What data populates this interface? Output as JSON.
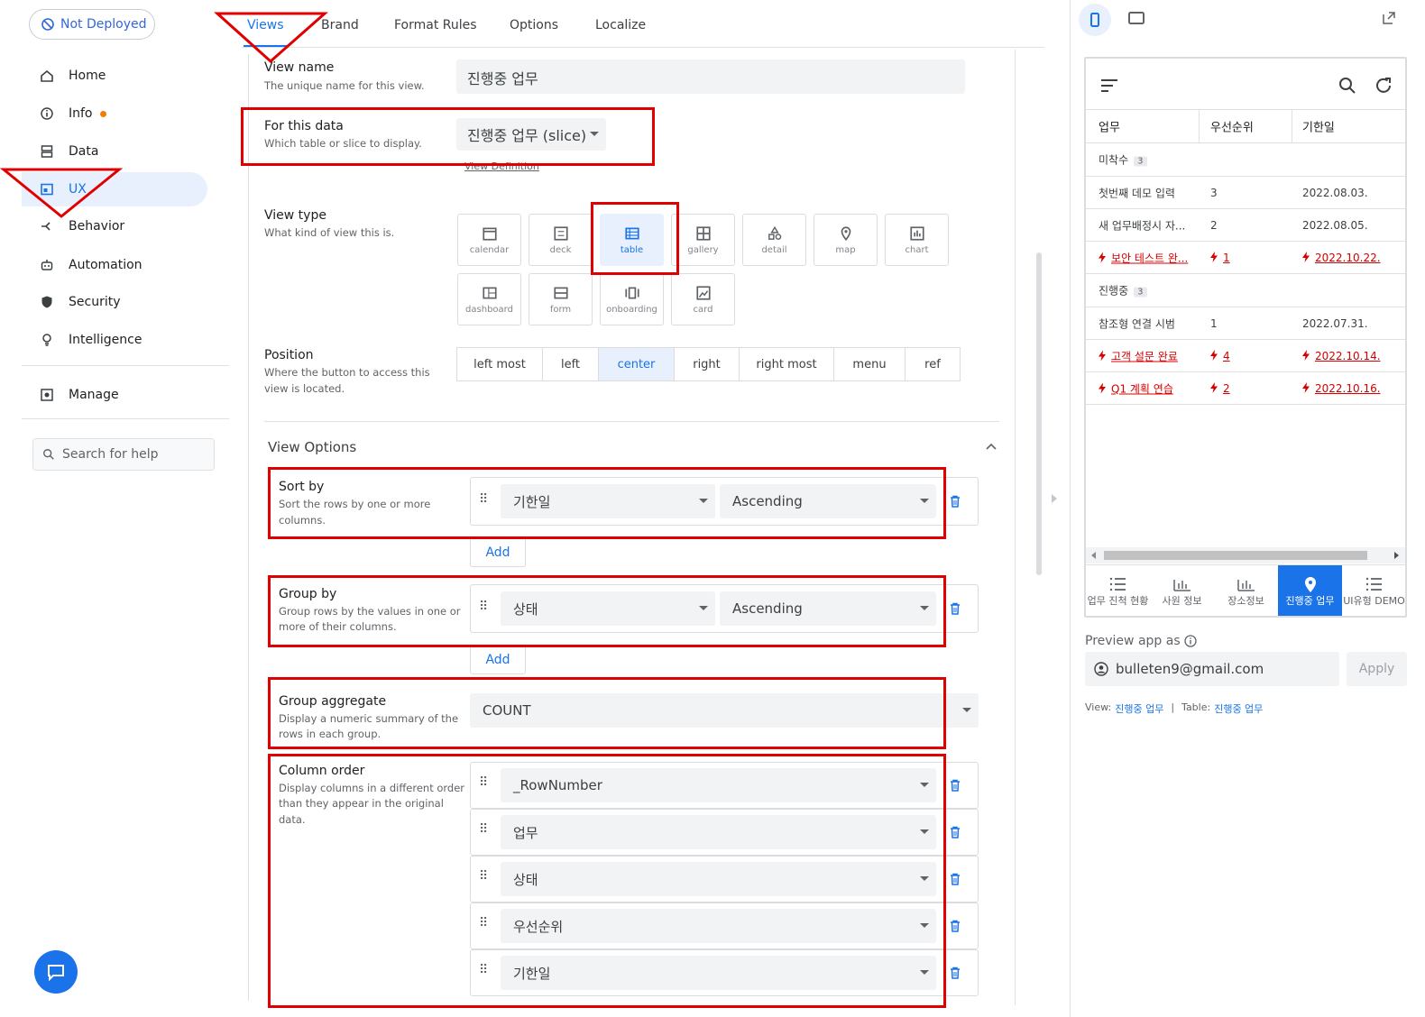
{
  "deploy": {
    "label": "Not Deployed"
  },
  "nav": {
    "items": [
      {
        "label": "Home",
        "icon": "home-icon"
      },
      {
        "label": "Info",
        "icon": "info-icon"
      },
      {
        "label": "Data",
        "icon": "data-icon"
      },
      {
        "label": "UX",
        "icon": "ux-icon"
      },
      {
        "label": "Behavior",
        "icon": "behavior-icon"
      },
      {
        "label": "Automation",
        "icon": "automation-icon"
      },
      {
        "label": "Security",
        "icon": "shield-icon"
      },
      {
        "label": "Intelligence",
        "icon": "lightbulb-icon"
      },
      {
        "label": "Manage",
        "icon": "manage-icon"
      }
    ],
    "search_placeholder": "Search for help"
  },
  "tabs": [
    "Views",
    "Brand",
    "Format Rules",
    "Options",
    "Localize"
  ],
  "form": {
    "view_name": {
      "label": "View name",
      "desc": "The unique name for this view.",
      "value": "진행중 업무"
    },
    "for_data": {
      "label": "For this data",
      "desc": "Which table or slice to display.",
      "value": "진행중 업무 (slice)",
      "link": "View Definition"
    },
    "view_type": {
      "label": "View type",
      "desc": "What kind of view this is.",
      "options": [
        "calendar",
        "deck",
        "table",
        "gallery",
        "detail",
        "map",
        "chart",
        "dashboard",
        "form",
        "onboarding",
        "card"
      ],
      "selected": "table"
    },
    "position": {
      "label": "Position",
      "desc1": "Where the button to access this",
      "desc2": "view is located.",
      "options": [
        "left most",
        "left",
        "center",
        "right",
        "right most",
        "menu",
        "ref"
      ],
      "selected": "center"
    },
    "view_options_title": "View Options",
    "sort_by": {
      "label": "Sort by",
      "desc1": "Sort the rows by one or more",
      "desc2": "columns.",
      "column": "기한일",
      "order": "Ascending",
      "add": "Add"
    },
    "group_by": {
      "label": "Group by",
      "desc1": "Group rows by the values in one or",
      "desc2": "more of their columns.",
      "column": "상태",
      "order": "Ascending",
      "add": "Add"
    },
    "group_aggregate": {
      "label": "Group aggregate",
      "desc1": "Display a numeric summary of the",
      "desc2": "rows in each group.",
      "value": "COUNT"
    },
    "column_order": {
      "label": "Column order",
      "desc1": "Display columns in a different order",
      "desc2": "than they appear in the original",
      "desc3": "data.",
      "columns": [
        "_RowNumber",
        "업무",
        "상태",
        "우선순위",
        "기한일"
      ]
    }
  },
  "preview": {
    "headers": [
      "업무",
      "우선순위",
      "기한일"
    ],
    "groups": [
      {
        "name": "미착수",
        "count": "3",
        "rows": [
          {
            "task": "첫번째 데모 입력",
            "priority": "3",
            "due": "2022.08.03.",
            "flag": false
          },
          {
            "task": "새 업무배정시 자...",
            "priority": "2",
            "due": "2022.08.05.",
            "flag": false
          },
          {
            "task": "보안 테스트 완...",
            "priority": "1",
            "due": "2022.10.22.",
            "flag": true
          }
        ]
      },
      {
        "name": "진행중",
        "count": "3",
        "rows": [
          {
            "task": "참조형 연결 시범",
            "priority": "1",
            "due": "2022.07.31.",
            "flag": false
          },
          {
            "task": "고객 설문 완료",
            "priority": "4",
            "due": "2022.10.14.",
            "flag": true
          },
          {
            "task": "Q1 계획 연습",
            "priority": "2",
            "due": "2022.10.16.",
            "flag": true
          }
        ]
      }
    ],
    "bottom_nav": [
      {
        "label": "업무 진척 현황",
        "icon": "list-icon"
      },
      {
        "label": "사원 정보",
        "icon": "bar-chart-icon"
      },
      {
        "label": "장소정보",
        "icon": "bar-chart-icon"
      },
      {
        "label": "진행중 업무",
        "icon": "map-pin-icon"
      },
      {
        "label": "UI유형 DEMO",
        "icon": "list-icon"
      }
    ],
    "preview_as_label": "Preview app as",
    "email": "bulleten9@gmail.com",
    "apply": "Apply",
    "footer_view_label": "View:",
    "footer_view_value": "진행중 업무",
    "footer_sep": "|",
    "footer_table_label": "Table:",
    "footer_table_value": "진행중 업무"
  },
  "colors": {
    "accent": "#1a73e8",
    "annotation": "#e00000",
    "flag": "#d50000"
  }
}
